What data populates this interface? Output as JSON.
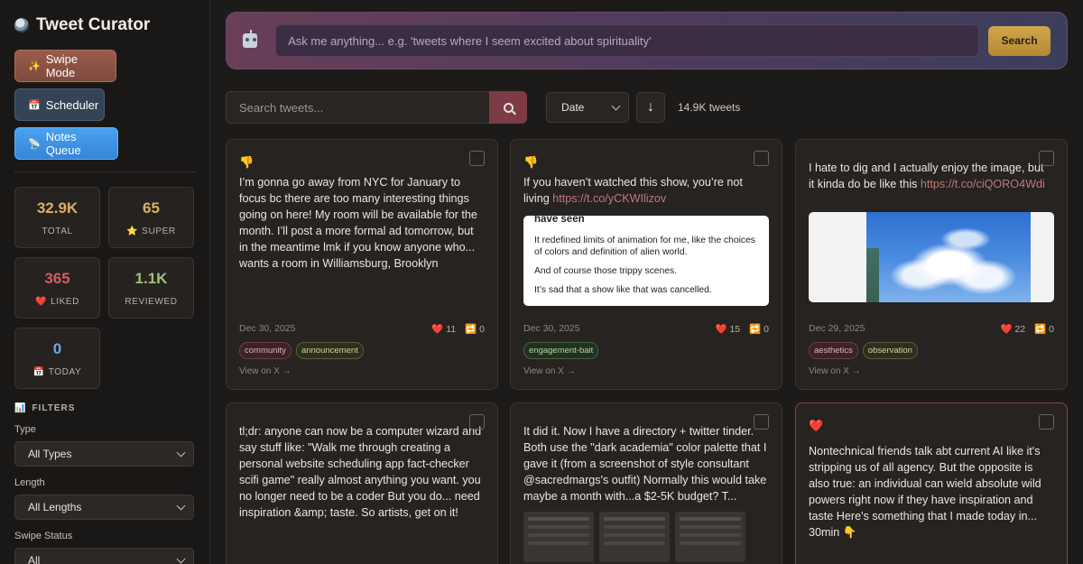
{
  "app": {
    "title": "Tweet Curator"
  },
  "modes": {
    "swipe": {
      "icon": "✨",
      "label": "Swipe Mode"
    },
    "scheduler": {
      "icon": "📅",
      "label": "Scheduler"
    },
    "notes": {
      "icon": "📡",
      "label": "Notes Queue"
    }
  },
  "stats": {
    "total": {
      "value": "32.9K",
      "label": "TOTAL"
    },
    "super": {
      "value": "65",
      "icon": "⭐",
      "label": "SUPER"
    },
    "liked": {
      "value": "365",
      "icon": "❤️",
      "label": "LIKED"
    },
    "reviewed": {
      "value": "1.1K",
      "label": "REVIEWED"
    },
    "today": {
      "value": "0",
      "icon": "📅",
      "label": "TODAY"
    }
  },
  "filters": {
    "title": "FILTERS",
    "type": {
      "label": "Type",
      "value": "All Types"
    },
    "length": {
      "label": "Length",
      "value": "All Lengths"
    },
    "swipe_status": {
      "label": "Swipe Status",
      "value": "All"
    }
  },
  "ai_search": {
    "placeholder": "Ask me anything... e.g. 'tweets where I seem excited about spirituality'",
    "button": "Search"
  },
  "toolbar": {
    "search_placeholder": "Search tweets...",
    "sort_value": "Date",
    "sort_direction": "↓",
    "count": "14.9K tweets"
  },
  "cards": [
    {
      "reaction": "👎",
      "text": "I’m gonna go away from NYC for January to focus bc there are too many interesting things going on here! My room will be available for the month. I’ll post a more formal ad tomorrow, but in the meantime lmk if you know anyone who... wants a room in Williamsburg, Brooklyn",
      "date": "Dec 30, 2025",
      "likes": "11",
      "retweets": "0",
      "tags": [
        "community",
        "announcement"
      ],
      "view": "View on X →"
    },
    {
      "reaction": "👎",
      "text": "If you haven’t watched this show, you’re not living ",
      "link": "https://t.co/yCKWIlizov",
      "preview": {
        "heading": "have seen",
        "p1": "It redefined limits of animation for me, like the choices of colors and definition of alien world.",
        "p2": "And of course those trippy scenes.",
        "p3": "It’s sad that a show like that was cancelled."
      },
      "date": "Dec 30, 2025",
      "likes": "15",
      "retweets": "0",
      "tags": [
        "engagement-bait"
      ],
      "view": "View on X →"
    },
    {
      "text": "I hate to dig and I actually enjoy the image, but it kinda do be like this ",
      "link": "https://t.co/ciQORO4Wdi",
      "date": "Dec 29, 2025",
      "likes": "22",
      "retweets": "0",
      "tags": [
        "aesthetics",
        "observation"
      ],
      "view": "View on X →"
    },
    {
      "text": "tl;dr: anyone can now be a computer wizard and say stuff like: \"Walk me through creating a personal website scheduling app fact-checker scifi game\" really almost anything you want. you no longer need to be a coder But you do... need inspiration &amp; taste. So artists, get on it!"
    },
    {
      "text": "It did it. Now I have a directory + twitter tinder. Both use the \"dark academia\" color palette that I gave it (from a screenshot of style consultant @sacredmargs's outfit) Normally this would take maybe a month with...a $2-5K budget? T..."
    },
    {
      "reaction": "❤️",
      "text": "Nontechnical friends talk abt current AI like it's stripping us of all agency. But the opposite is also true: an individual can wield absolute wild powers right now if they have inspiration and taste Here's something that I made today in... 30min 👇"
    }
  ],
  "colors": {
    "accent_gold": "#d1a54a",
    "liked_red": "#cf5f63",
    "link": "#c2787b"
  }
}
